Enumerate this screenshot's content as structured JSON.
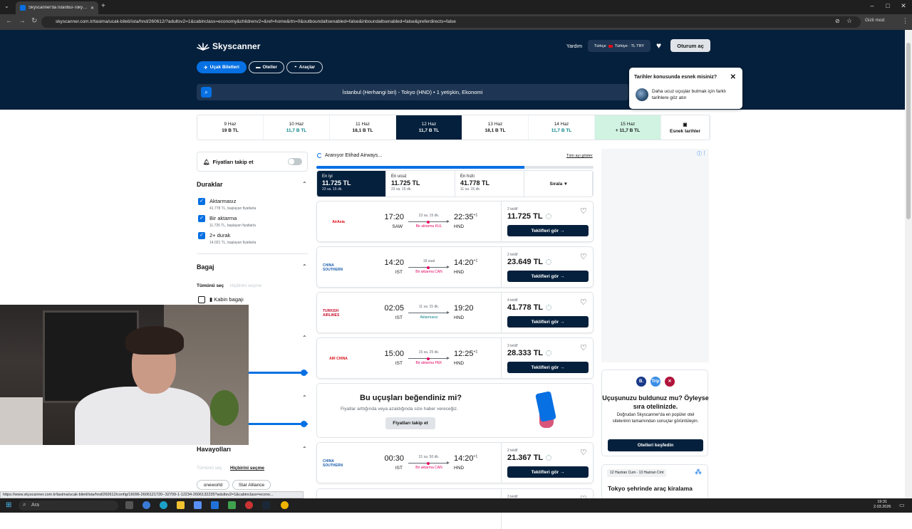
{
  "browser": {
    "tab_title": "Skyscanner'da İstanbul-Tokyo u",
    "url": "skyscanner.com.tr/tasima/ucak-bileti/ista/hnd/260612/?adultsv2=1&cabinclass=economy&childrenv2=&ref=home&rtn=0&outboundaltsenabled=false&inboundaltsenabled=false&preferdirects=false",
    "incognito": "Gizli mod",
    "status_url": "https://www.skyscanner.com.tr/tasima/ucak-bileti/ista/hnd/260612/config/16096-2606121720--32709-1-12234-2606132235?adultsv2=1&cabinclass=econo..."
  },
  "header": {
    "brand": "Skyscanner",
    "help": "Yardım",
    "lang": "Türkçe",
    "region": "Türkiye · TL TRY",
    "login": "Oturum aç",
    "pills": [
      "Uçak Biletleri",
      "Oteller",
      "Araçlar"
    ],
    "search_summary": "İstanbul (Herhangi biri) - Tokyo (HND)  •  1 yetişkin, Ekonomi"
  },
  "tooltip": {
    "title": "Tarihler konusunda esnek misiniz?",
    "text": "Daha ucuz uçuşlar bulmak için farklı tarihlere göz atın"
  },
  "dates": [
    {
      "day": "9 Haz",
      "price": "19 B TL"
    },
    {
      "day": "10 Haz",
      "price": "11,7 B TL"
    },
    {
      "day": "11 Haz",
      "price": "18,1 B TL"
    },
    {
      "day": "12 Haz",
      "price": "11,7 B TL"
    },
    {
      "day": "13 Haz",
      "price": "18,1 B TL"
    },
    {
      "day": "14 Haz",
      "price": "11,7 B TL"
    },
    {
      "day": "15 Haz",
      "price": "+ 11,7 B TL"
    }
  ],
  "flex_dates": "Esnek tarihler",
  "sidebar": {
    "track": "Fiyatları takip et",
    "stops_title": "Duraklar",
    "stops": [
      {
        "label": "Aktarmasız",
        "sub": "41.778 TL, başlayan fiyatlarla"
      },
      {
        "label": "Bir aktarma",
        "sub": "11.725 TL, başlayan fiyatlarla"
      },
      {
        "label": "2+ durak",
        "sub": "14.021 TL, başlayan fiyatlarla"
      }
    ],
    "baggage_title": "Bagaj",
    "select_all": "Tümünü seç",
    "select_none": "Hiçbirini seçme",
    "cabin_bag": "Kabin bagajı",
    "airlines_title": "Havayolları",
    "airline_chips": [
      "oneworld",
      "Star Alliance"
    ]
  },
  "results": {
    "searching": "Aranıyor Etihad Airways...",
    "all_month": "Tüm ayı göster",
    "progress_pct": 75,
    "sort_tabs": [
      {
        "label": "En iyi",
        "price": "11.725 TL",
        "detail": "23 sa. 15 dk."
      },
      {
        "label": "En ucuz",
        "price": "11.725 TL",
        "detail": "23 sa. 15 dk."
      },
      {
        "label": "En hızlı",
        "price": "41.778 TL",
        "detail": "11 sa. 15 dk."
      }
    ],
    "sort_label": "Sırala",
    "flights": [
      {
        "airline": "AirAsia",
        "color": "#e3000f",
        "dep": "17:20",
        "arr": "22:35",
        "plus": "+1",
        "from": "SAW",
        "to": "HND",
        "dur": "23 sa. 15 dk.",
        "stops": "Bir aktarma KUL",
        "direct": false,
        "deals": "2 teklif",
        "price": "11.725 TL"
      },
      {
        "airline": "CHINA SOUTHERN",
        "color": "#2160ad",
        "dep": "14:20",
        "arr": "14:20",
        "plus": "+1",
        "from": "IST",
        "to": "HND",
        "dur": "18 saat",
        "stops": "Bir aktarma CAN",
        "direct": false,
        "deals": "2 teklif",
        "price": "23.649 TL"
      },
      {
        "airline": "TURKISH AIRLINES",
        "color": "#c8102e",
        "dep": "02:05",
        "arr": "19:20",
        "plus": "",
        "from": "IST",
        "to": "HND",
        "dur": "11 sa. 15 dk.",
        "stops": "Aktarmasız",
        "direct": true,
        "deals": "4 teklif",
        "price": "41.778 TL"
      },
      {
        "airline": "AIR CHINA",
        "color": "#d7141a",
        "dep": "15:00",
        "arr": "12:25",
        "plus": "+1",
        "from": "IST",
        "to": "HND",
        "dur": "15 sa. 25 dk.",
        "stops": "Bir aktarma PEK",
        "direct": false,
        "deals": "3 teklif",
        "price": "28.333 TL"
      },
      {
        "airline": "CHINA SOUTHERN",
        "color": "#2160ad",
        "dep": "00:30",
        "arr": "14:20",
        "plus": "+1",
        "from": "IST",
        "to": "HND",
        "dur": "31 sa. 50 dk.",
        "stops": "Bir aktarma CAN",
        "direct": false,
        "deals": "2 teklif",
        "price": "21.367 TL"
      }
    ],
    "cta": "Teklifleri gör →",
    "promo": {
      "title": "Bu uçuşları beğendiniz mi?",
      "text": "Fiyatlar arttığında veya azaldığında size haber vereceğiz.",
      "button": "Fiyatları takip et"
    },
    "last_deals": "3 teklif"
  },
  "right": {
    "hotel_title": "Uçuşunuzu buldunuz mu? Öyleyse sıra otelinizde.",
    "hotel_text": "Doğrudan Skyscanner'da en popüler otel sitelerinin tamamından sonuçlar görüntüleyin.",
    "hotel_btn": "Otelleri keşfedin",
    "car_tag": "12 Haziran Cum - 13 Haziran Cmt",
    "car_title": "Tokyo şehrinde araç kiralama"
  },
  "taskbar": {
    "search": "Ara",
    "time": "19:31",
    "date": "2.03.2026"
  }
}
